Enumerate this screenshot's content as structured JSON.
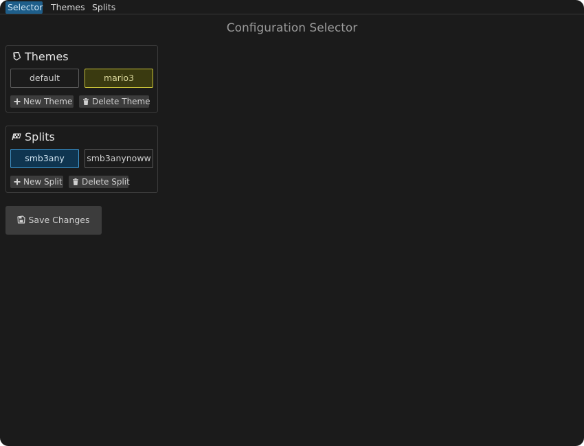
{
  "menu": {
    "items": [
      {
        "label": "Selector",
        "active": true
      },
      {
        "label": "Themes",
        "active": false
      },
      {
        "label": "Splits",
        "active": false
      }
    ]
  },
  "page": {
    "title": "Configuration Selector"
  },
  "themes": {
    "header": "Themes",
    "header_icon": "palette-icon",
    "options": [
      {
        "label": "default",
        "selected": false
      },
      {
        "label": "mario3",
        "selected": true
      }
    ],
    "new_label": "New Theme",
    "delete_label": "Delete Theme"
  },
  "splits": {
    "header": "Splits",
    "header_icon": "checkered-flag-icon",
    "options": [
      {
        "label": "smb3any",
        "selected": true
      },
      {
        "label": "smb3anynoww",
        "selected": false
      }
    ],
    "new_label": "New Split",
    "delete_label": "Delete Split"
  },
  "actions": {
    "save_label": "Save Changes",
    "save_icon": "save-icon"
  },
  "colors": {
    "background": "#1b1b1b",
    "menu_active": "#1e5e8a",
    "theme_selected_border": "#c8c23a",
    "theme_selected_bg": "#3a3a10",
    "split_selected_border": "#3f93c9",
    "split_selected_bg": "#0f3550",
    "button_bg": "#3c3c3c"
  }
}
